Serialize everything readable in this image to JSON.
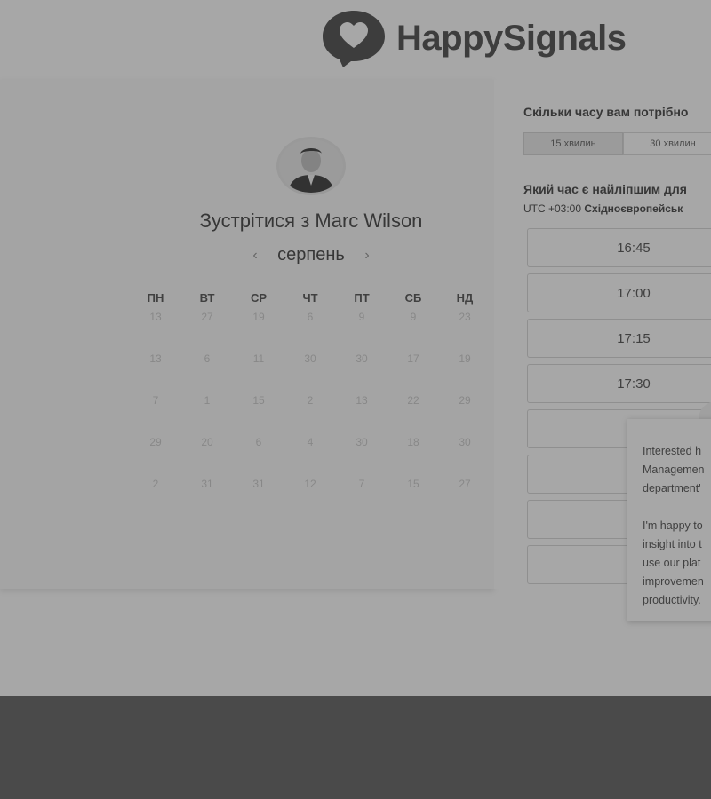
{
  "brand": {
    "name": "HappySignals",
    "accent": "#4a4a4a"
  },
  "calendar": {
    "title": "Зустрітися з Marc Wilson",
    "month": "серпень",
    "prev_icon": "chevron-left-icon",
    "next_icon": "chevron-right-icon",
    "weekdays": [
      "ПН",
      "ВТ",
      "СР",
      "ЧТ",
      "ПТ",
      "СБ",
      "НД"
    ],
    "days": [
      [
        "13",
        "27",
        "19",
        "6",
        "9",
        "9",
        "23"
      ],
      [
        "13",
        "6",
        "11",
        "30",
        "30",
        "17",
        "19"
      ],
      [
        "7",
        "1",
        "15",
        "2",
        "13",
        "22",
        "29"
      ],
      [
        "29",
        "20",
        "6",
        "4",
        "30",
        "18",
        "30"
      ],
      [
        "2",
        "31",
        "31",
        "12",
        "7",
        "15",
        "27"
      ]
    ]
  },
  "scheduler": {
    "duration_question": "Скільки часу вам потрібно",
    "durations": [
      "15 хвилин",
      "30 хвилин"
    ],
    "time_question": "Який час є найліпшим для",
    "timezone_offset": "UTC +03:00",
    "timezone_name": "Східноєвропейськ",
    "slots": [
      "16:45",
      "17:00",
      "17:15",
      "17:30",
      "",
      "",
      "",
      ""
    ]
  },
  "chat": {
    "message": "Interested h\nManagemen\ndepartment'\n\nI'm happy to\ninsight into t\nuse our plat\nimprovemen\nproductivity."
  }
}
